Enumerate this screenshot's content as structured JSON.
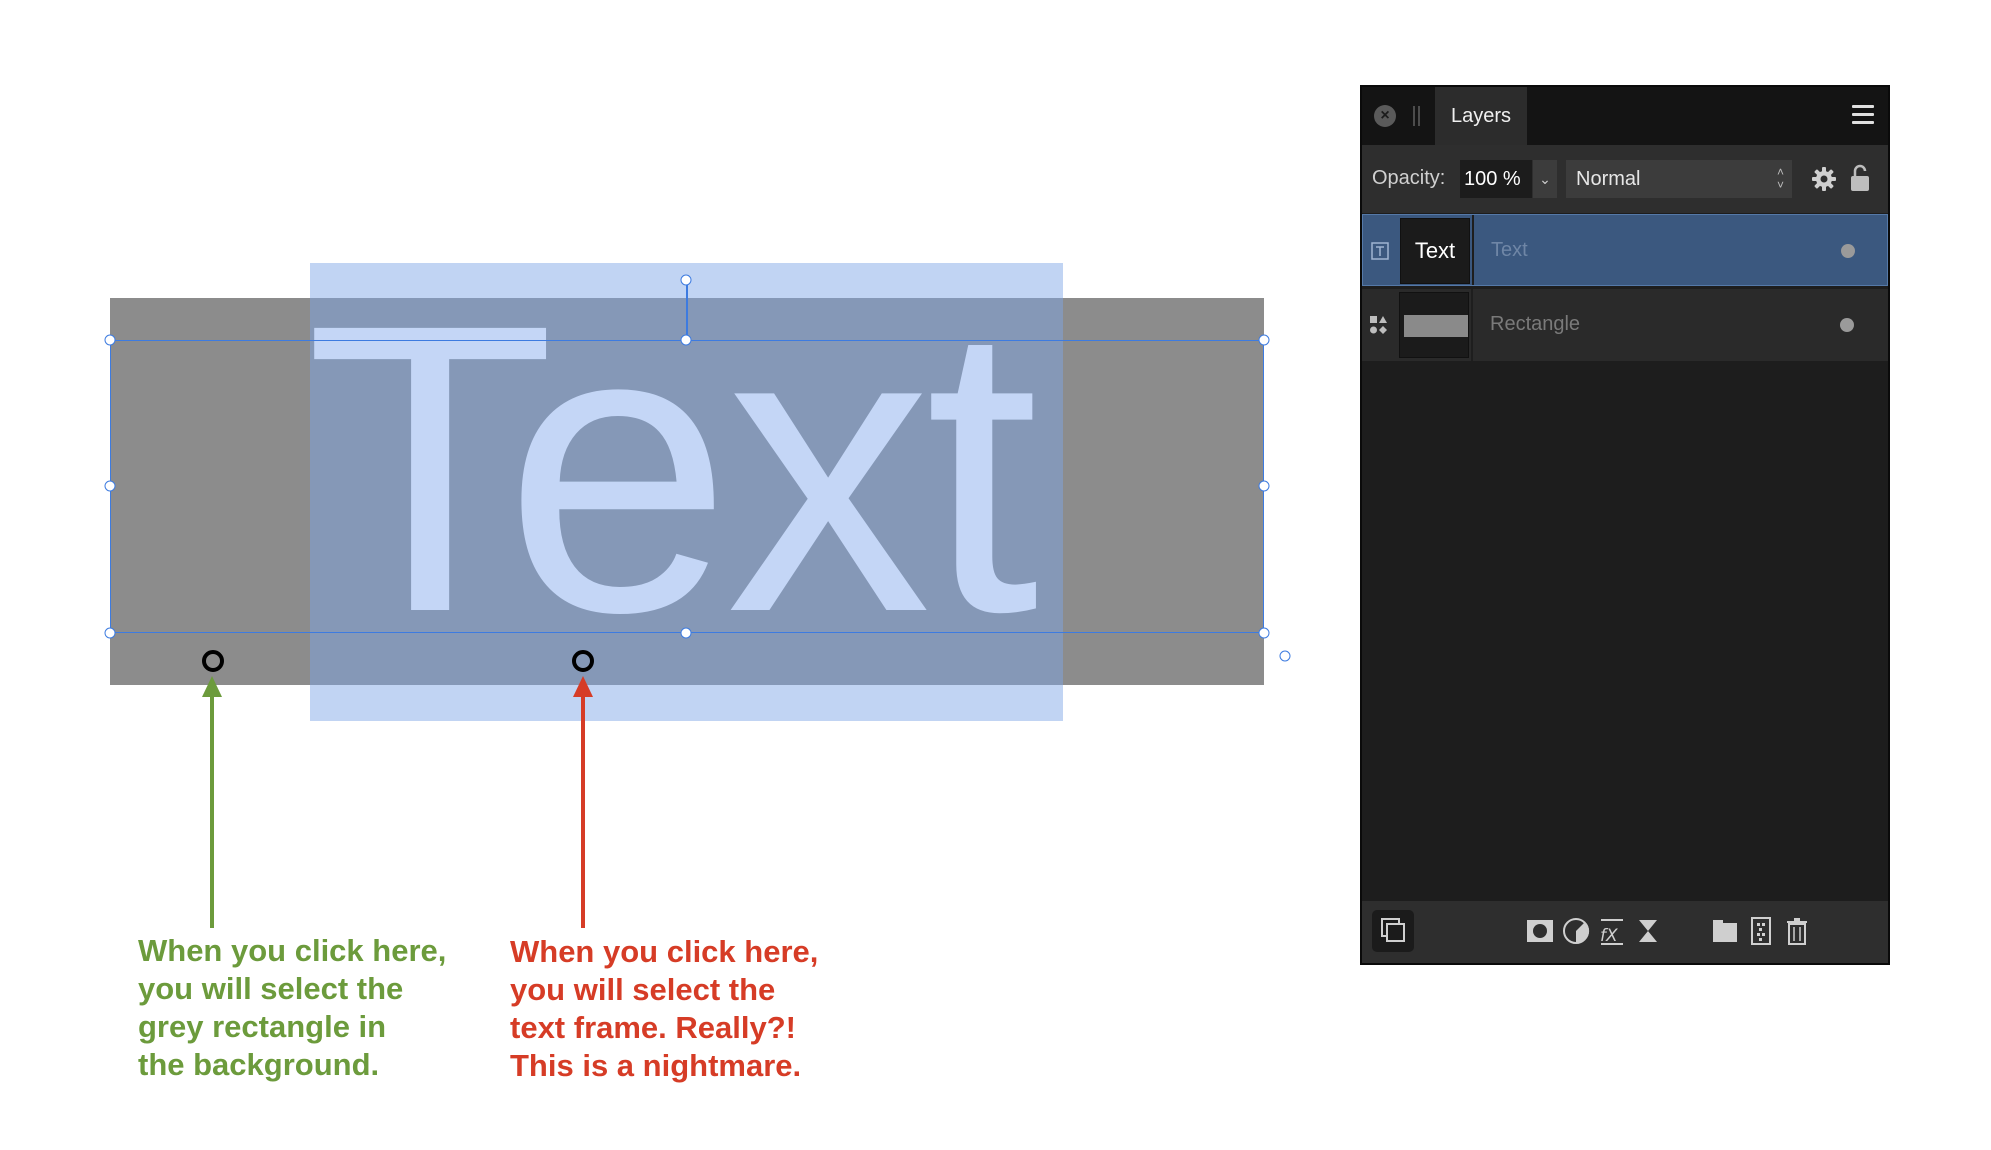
{
  "canvas": {
    "big_text": "Text",
    "note_green": [
      "When you click here,",
      "you will select the",
      "grey rectangle in",
      "the background."
    ],
    "note_red": [
      "When you click here,",
      "you will select the",
      "text frame. Really?!",
      "This is a nightmare."
    ],
    "colors": {
      "green": "#6c9b3c",
      "red": "#d63c26",
      "selection": "#3d7be0",
      "grey_rect": "#8c8c8c",
      "text_frame": "#b8cdf0"
    }
  },
  "panel": {
    "tab_label": "Layers",
    "opacity_label": "Opacity:",
    "opacity_value": "100 %",
    "blend_mode": "Normal",
    "layers": [
      {
        "thumb": "Text",
        "name": "Text",
        "type": "text-layer-icon",
        "selected": true
      },
      {
        "thumb": "",
        "name": "Rectangle",
        "type": "shape-layer-icon",
        "selected": false
      }
    ],
    "bottom_icons": [
      "arrange-icon",
      "mask-icon",
      "adjustment-icon",
      "fx-icon",
      "live-filter-icon",
      "group-icon",
      "pixel-layer-icon",
      "delete-icon"
    ]
  }
}
